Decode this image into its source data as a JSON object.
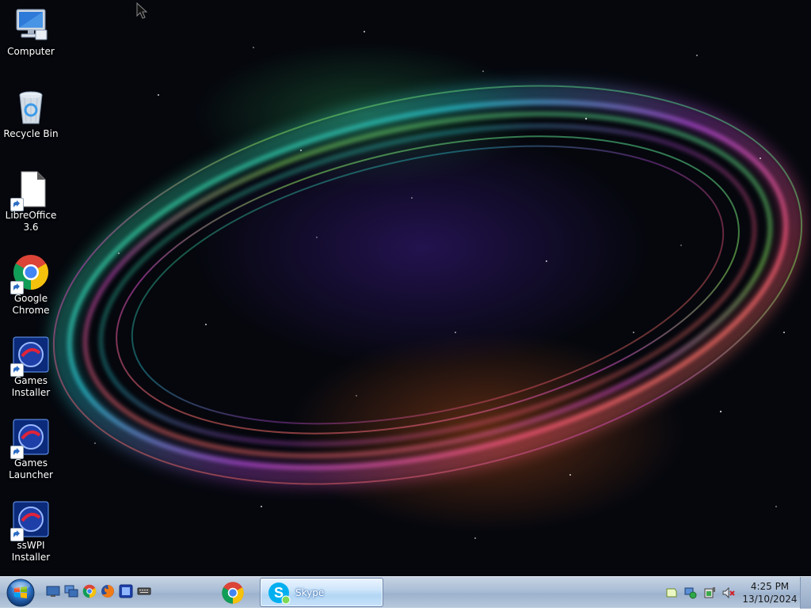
{
  "desktop": {
    "icons": [
      {
        "label": "Computer",
        "icon": "computer-icon"
      },
      {
        "label": "Recycle Bin",
        "icon": "recycle-bin-icon"
      },
      {
        "label": "LibreOffice\n3.6",
        "icon": "libreoffice-icon"
      },
      {
        "label": "Google\nChrome",
        "icon": "chrome-icon"
      },
      {
        "label": "Games\nInstaller",
        "icon": "games-installer-icon"
      },
      {
        "label": "Games\nLauncher",
        "icon": "games-launcher-icon"
      },
      {
        "label": "ssWPI\nInstaller",
        "icon": "sswpi-installer-icon"
      }
    ]
  },
  "taskbar": {
    "quick_launch": [
      "show-desktop-icon",
      "switch-windows-icon",
      "chrome-icon",
      "firefox-icon",
      "app-icon",
      "keyboard-icon"
    ],
    "pinned": [
      {
        "icon": "chrome-icon"
      }
    ],
    "active_window": {
      "label": "Skype",
      "icon": "skype-icon"
    },
    "tray_icons": [
      "action-center-icon",
      "network-icon",
      "battery-icon",
      "volume-muted-icon"
    ],
    "clock": {
      "time": "4:25 PM",
      "date": "13/10/2024"
    }
  },
  "colors": {
    "taskbar_top": "#c6d3e3",
    "taskbar_bottom": "#9db2cd",
    "desktop_bg": "#05070d",
    "label_text": "#ffffff"
  }
}
